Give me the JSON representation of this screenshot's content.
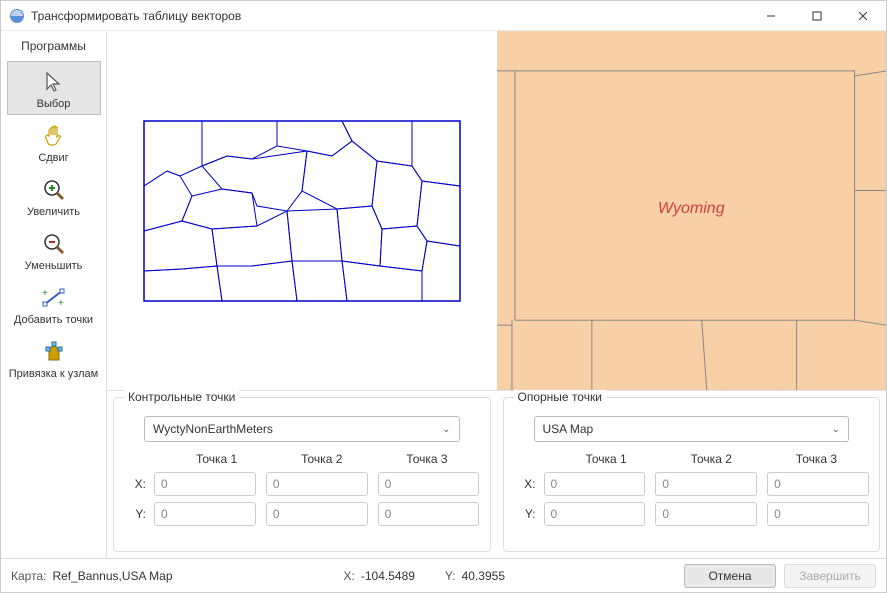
{
  "window": {
    "title": "Трансформировать таблицу векторов"
  },
  "sidebar": {
    "header": "Программы",
    "tools": [
      {
        "label": "Выбор"
      },
      {
        "label": "Сдвиг"
      },
      {
        "label": "Увеличить"
      },
      {
        "label": "Уменьшить"
      },
      {
        "label": "Добавить точки"
      },
      {
        "label": "Привязка к узлам"
      }
    ]
  },
  "map_right": {
    "label": "Wyoming"
  },
  "panel_left": {
    "title": "Контрольные точки",
    "dropdown": "WyctyNonEarthMeters",
    "points": [
      "Точка 1",
      "Точка 2",
      "Точка 3"
    ],
    "rows": {
      "X": [
        "0",
        "0",
        "0"
      ],
      "Y": [
        "0",
        "0",
        "0"
      ]
    },
    "xlabel": "X:",
    "ylabel": "Y:"
  },
  "panel_right": {
    "title": "Опорные точки",
    "dropdown": "USA Map",
    "points": [
      "Точка 1",
      "Точка 2",
      "Точка 3"
    ],
    "rows": {
      "X": [
        "0",
        "0",
        "0"
      ],
      "Y": [
        "0",
        "0",
        "0"
      ]
    },
    "xlabel": "X:",
    "ylabel": "Y:"
  },
  "status": {
    "map_label": "Карта:",
    "map_value": "Ref_Bannus,USA Map",
    "x_label": "X:",
    "x_value": "-104.5489",
    "y_label": "Y:",
    "y_value": "40.3955",
    "cancel": "Отмена",
    "finish": "Завершить"
  }
}
